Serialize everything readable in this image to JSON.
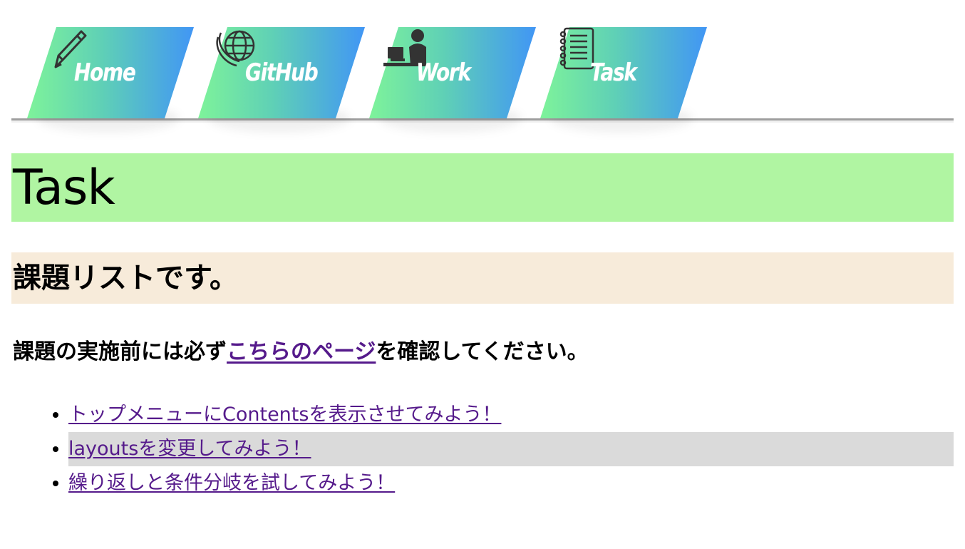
{
  "nav": {
    "tabs": [
      {
        "label": "Home",
        "icon": "pencil-icon"
      },
      {
        "label": "GitHub",
        "icon": "globe-icon"
      },
      {
        "label": "Work",
        "icon": "person-at-desk-icon"
      },
      {
        "label": "Task",
        "icon": "notebook-icon"
      }
    ],
    "gradient": [
      "#7ef39a",
      "#4196f5"
    ]
  },
  "main": {
    "title": "Task",
    "subtitle": "課題リストです。",
    "notice": {
      "before": "課題の実施前には必ず",
      "link": "こちらのページ",
      "after": "を確認してください。"
    },
    "tasks": [
      "トップメニューにContentsを表示させてみよう！",
      "layoutsを変更してみよう！",
      "繰り返しと条件分岐を試してみよう！"
    ]
  },
  "colors": {
    "title_bg": "#b0f5a2",
    "subtitle_bg": "#f7ebda",
    "link": "#551a8b",
    "row_highlight": "#dadada"
  }
}
